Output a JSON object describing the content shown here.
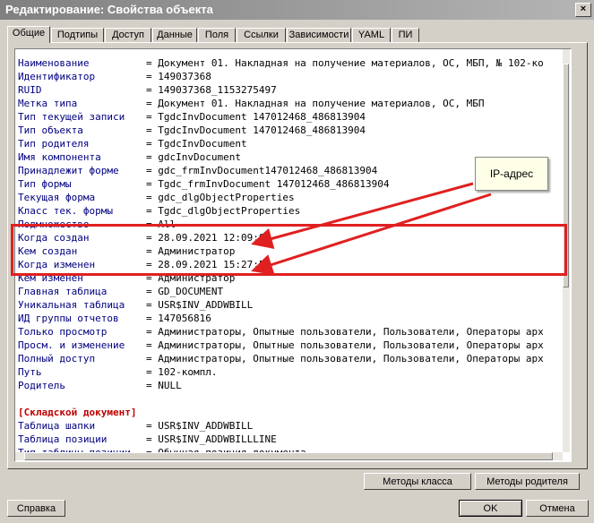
{
  "window": {
    "title": "Редактирование: Свойства объекта",
    "close_glyph": "×"
  },
  "tabs": [
    "Общие",
    "Подтипы",
    "Доступ",
    "Данные",
    "Поля",
    "Ссылки",
    "Зависимости",
    "YAML",
    "ПИ"
  ],
  "active_tab": 0,
  "properties": [
    {
      "key": "Наименование",
      "value": "= Документ 01. Накладная на получение материалов, ОС, МБП, № 102-ко"
    },
    {
      "key": "Идентификатор",
      "value": "= 149037368"
    },
    {
      "key": "RUID",
      "value": "= 149037368_1153275497"
    },
    {
      "key": "Метка типа",
      "value": "= Документ 01. Накладная на получение материалов, ОС, МБП"
    },
    {
      "key": "Тип текущей записи",
      "value": "= TgdcInvDocument 147012468_486813904"
    },
    {
      "key": "Тип объекта",
      "value": "= TgdcInvDocument 147012468_486813904"
    },
    {
      "key": "Тип родителя",
      "value": "= TgdcInvDocument"
    },
    {
      "key": "Имя компонента",
      "value": "= gdcInvDocument"
    },
    {
      "key": "Принадлежит форме",
      "value": "= gdc_frmInvDocument147012468_486813904"
    },
    {
      "key": "Тип формы",
      "value": "= Tgdc_frmInvDocument 147012468_486813904"
    },
    {
      "key": "Текущая форма",
      "value": "= gdc_dlgObjectProperties"
    },
    {
      "key": "Класс тек. формы",
      "value": "= Tgdc_dlgObjectProperties"
    },
    {
      "key": "Подмножество",
      "value": "= All"
    },
    {
      "key": "Когда создан",
      "value": "= 28.09.2021 12:09:00"
    },
    {
      "key": "Кем создан",
      "value": "= Администратор"
    },
    {
      "key": "Когда изменен",
      "value": "= 28.09.2021 15:27:59"
    },
    {
      "key": "Кем изменен",
      "value": "= Администратор"
    },
    {
      "key": "Главная таблица",
      "value": "= GD_DOCUMENT"
    },
    {
      "key": "Уникальная таблица",
      "value": "= USR$INV_ADDWBILL"
    },
    {
      "key": "ИД группы отчетов",
      "value": "= 147056816"
    },
    {
      "key": "Только просмотр",
      "value": "= Администраторы, Опытные пользователи, Пользователи, Операторы арх"
    },
    {
      "key": "Просм. и изменение",
      "value": "= Администраторы, Опытные пользователи, Пользователи, Операторы арх"
    },
    {
      "key": "Полный доступ",
      "value": "= Администраторы, Опытные пользователи, Пользователи, Операторы арх"
    },
    {
      "key": "Путь",
      "value": "= 102-компл."
    },
    {
      "key": "Родитель",
      "value": "= NULL"
    }
  ],
  "section_title": "[Складской документ]",
  "section_properties": [
    {
      "key": "Таблица шапки",
      "value": "= USR$INV_ADDWBILL"
    },
    {
      "key": "Таблица позиции",
      "value": "= USR$INV_ADDWBILLLINE"
    },
    {
      "key": "Тип таблицы позиции",
      "value": "= Обычная позиция документа"
    }
  ],
  "buttons": {
    "class_methods": "Методы класса",
    "parent_methods": "Методы родителя",
    "help": "Справка",
    "ok": "OK",
    "cancel": "Отмена"
  },
  "annotation": {
    "label": "IP-адрес",
    "color": "#e02020"
  }
}
